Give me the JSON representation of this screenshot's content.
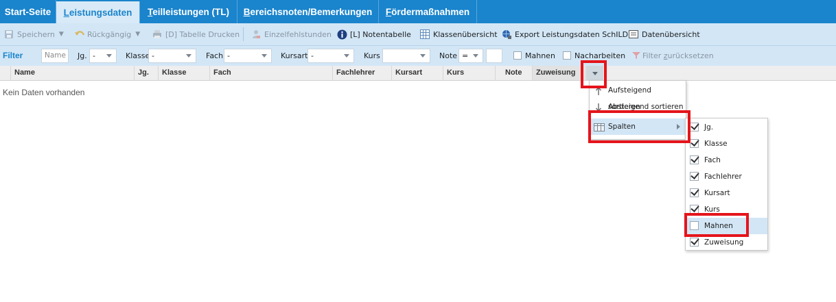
{
  "tabs": [
    {
      "label": "Start-Seite"
    },
    {
      "label_u": "L",
      "label_rest": "eistungsdaten"
    },
    {
      "label_u": "T",
      "label_rest": "eilleistungen (TL)"
    },
    {
      "label_u": "B",
      "label_rest": "ereichsnoten/Bemerkungen"
    },
    {
      "label_u": "F",
      "label_rest": "ördermaßnahmen"
    }
  ],
  "toolbar": {
    "save": "Speichern",
    "undo": "Rückgängig",
    "print": "[D] Tabelle Drucken",
    "absences": "Einzelfehlstunden",
    "grade_table": "[L] Notentabelle",
    "class_overview": "Klassenübersicht",
    "export": "Export Leistungsdaten SchILD",
    "data_overview": "Datenübersicht"
  },
  "filter": {
    "title": "Filter",
    "name_placeholder": "Name",
    "jg_label": "Jg.",
    "jg_value": "-",
    "klasse_label": "Klasse",
    "klasse_value": "-",
    "fach_label": "Fach",
    "fach_value": "-",
    "kursart_label": "Kursart",
    "kursart_value": "-",
    "kurs_label": "Kurs",
    "kurs_value": "",
    "note_label": "Note",
    "note_value": "=",
    "mahnen_label": "Mahnen",
    "nacharbeiten_label": "Nacharbeiten",
    "reset_label_pre": "Filter ",
    "reset_label_u": "z",
    "reset_label_post": "urücksetzen"
  },
  "grid": {
    "columns": [
      "Name",
      "Jg.",
      "Klasse",
      "Fach",
      "Fachlehrer",
      "Kursart",
      "Kurs",
      "Note",
      "Zuweisung"
    ],
    "empty_text": "Kein Daten vorhanden"
  },
  "column_menu": {
    "sort_asc": "Aufsteigend sortieren",
    "sort_desc": "Absteigend sortieren",
    "columns": "Spalten"
  },
  "columns_submenu": [
    {
      "label": "Jg.",
      "checked": true
    },
    {
      "label": "Klasse",
      "checked": true
    },
    {
      "label": "Fach",
      "checked": true
    },
    {
      "label": "Fachlehrer",
      "checked": true
    },
    {
      "label": "Kursart",
      "checked": true
    },
    {
      "label": "Kurs",
      "checked": true
    },
    {
      "label": "Mahnen",
      "checked": false
    },
    {
      "label": "Zuweisung",
      "checked": true
    }
  ],
  "colors": {
    "accent": "#1a84cc",
    "highlight": "#e5141b",
    "toolbar_bg": "#d2e6f6"
  }
}
